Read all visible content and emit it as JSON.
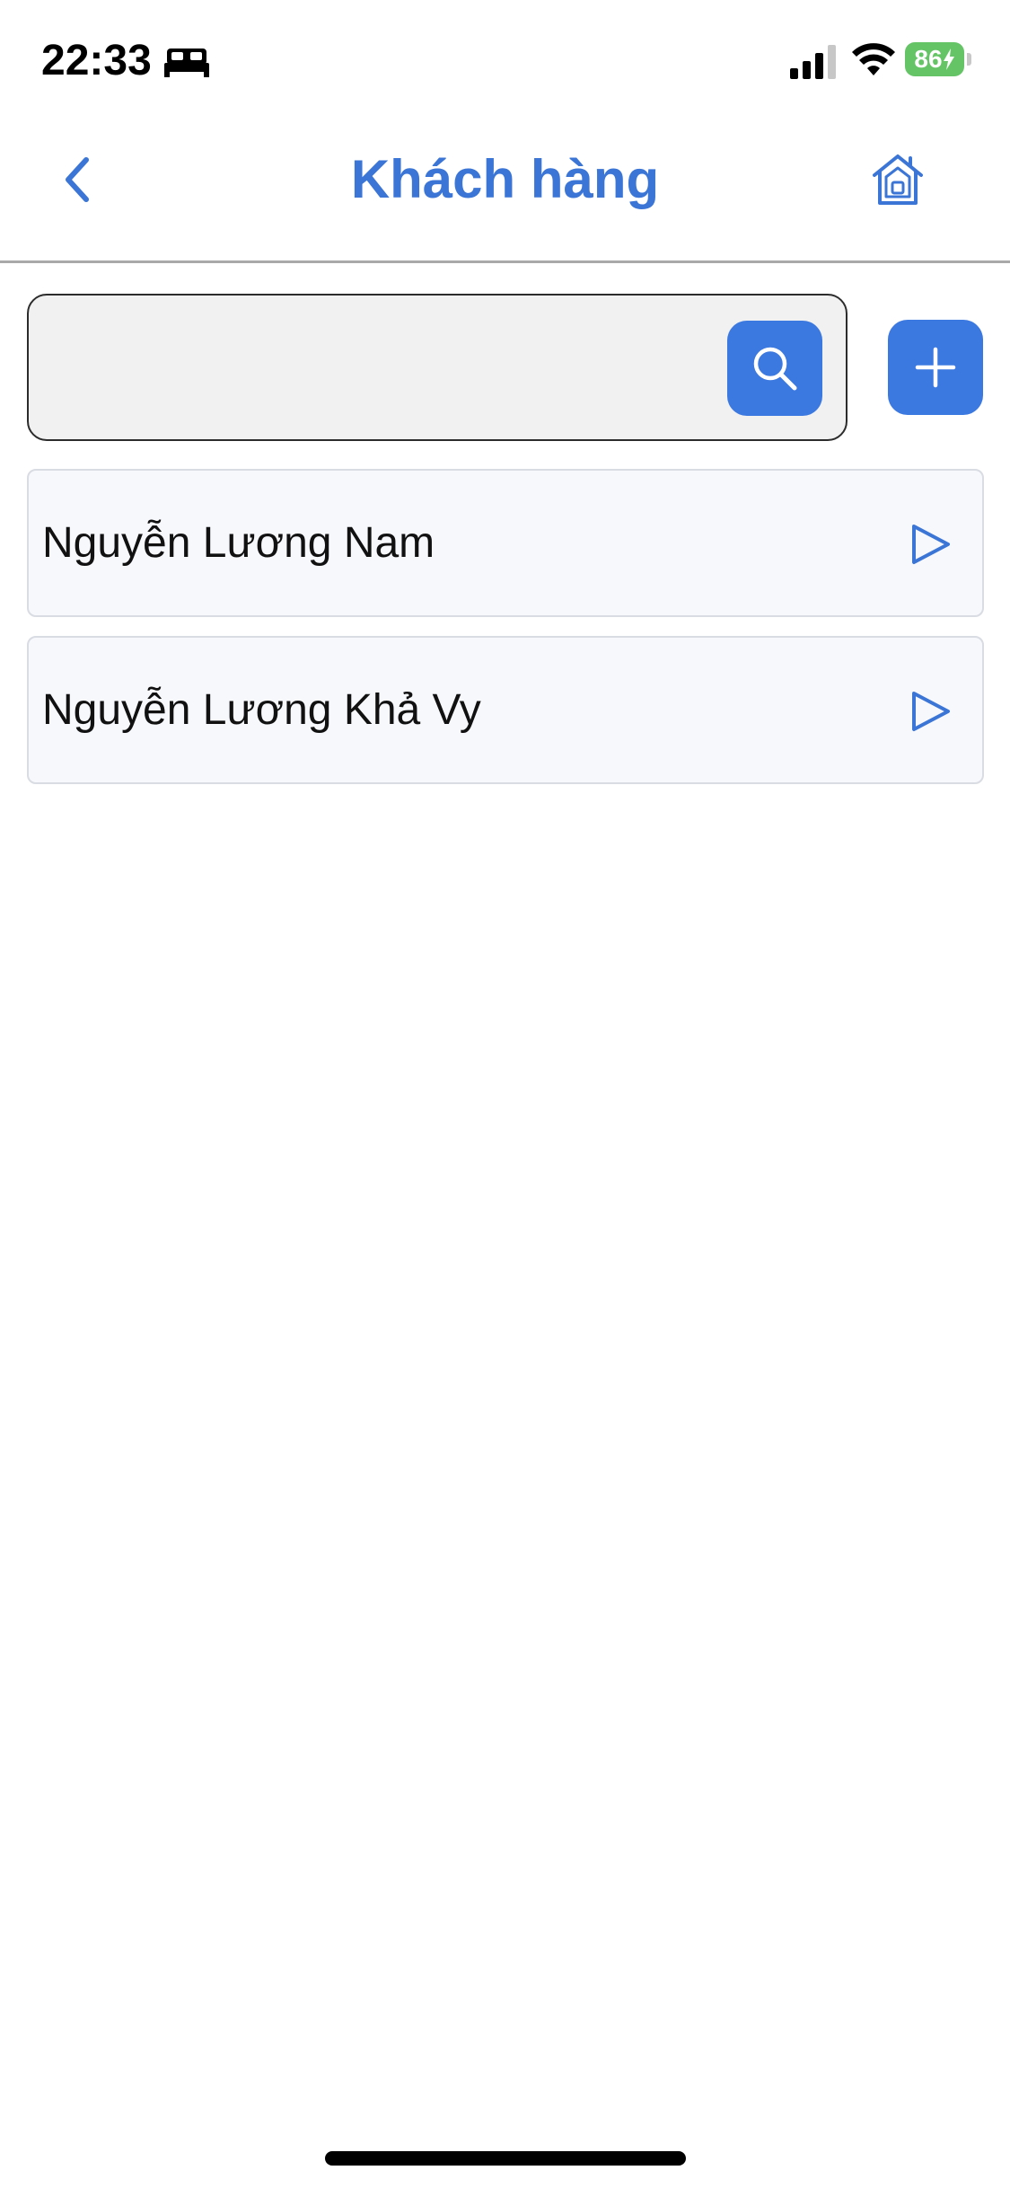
{
  "status_bar": {
    "time": "22:33",
    "battery_level": "86",
    "icons": [
      "bed-icon",
      "signal-icon",
      "wifi-icon",
      "battery-charging-icon"
    ]
  },
  "header": {
    "title": "Khách hàng",
    "back_icon": "chevron-left-icon",
    "home_icon": "home-icon"
  },
  "search": {
    "value": "",
    "placeholder": "",
    "button_icon": "search-icon"
  },
  "add_button": {
    "icon": "plus-icon"
  },
  "customers": [
    {
      "name": "Nguyễn Lương Nam"
    },
    {
      "name": "Nguyễn Lương Khả Vy"
    }
  ],
  "colors": {
    "accent": "#3b78e0",
    "title": "#3b75d6",
    "battery": "#65c466"
  }
}
